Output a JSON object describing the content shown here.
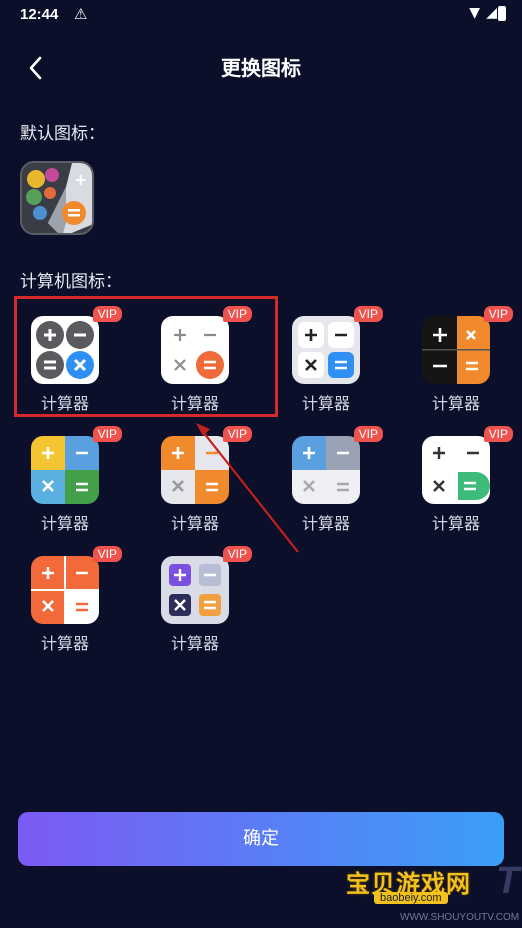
{
  "status_bar": {
    "time": "12:44",
    "alert_glyph": "⚠"
  },
  "header": {
    "title": "更换图标"
  },
  "default_section": {
    "label": "默认图标："
  },
  "computer_section": {
    "label": "计算机图标："
  },
  "icons": [
    {
      "label": "计算器",
      "vip": "VIP",
      "style": "dark-circles"
    },
    {
      "label": "计算器",
      "vip": "VIP",
      "style": "light-orange"
    },
    {
      "label": "计算器",
      "vip": "VIP",
      "style": "light-blue"
    },
    {
      "label": "计算器",
      "vip": "VIP",
      "style": "black-orange"
    },
    {
      "label": "计算器",
      "vip": "VIP",
      "style": "four-color"
    },
    {
      "label": "计算器",
      "vip": "VIP",
      "style": "orange-tiles"
    },
    {
      "label": "计算器",
      "vip": "VIP",
      "style": "blue-gray"
    },
    {
      "label": "计算器",
      "vip": "VIP",
      "style": "white-green"
    },
    {
      "label": "计算器",
      "vip": "VIP",
      "style": "orange-white"
    },
    {
      "label": "计算器",
      "vip": "VIP",
      "style": "purple-gray"
    }
  ],
  "confirm_button": {
    "label": "确定"
  },
  "watermark": {
    "name": "宝贝游戏网",
    "domain": "baobeiy.com",
    "tv": "TV",
    "url": "WWW.SHOUYOUTV.COM"
  },
  "colors": {
    "background": "#0b0f2a",
    "vip_badge": "#f0524e",
    "highlight": "#d42a2a",
    "button_start": "#7c5af5",
    "button_end": "#3a9ff6"
  }
}
